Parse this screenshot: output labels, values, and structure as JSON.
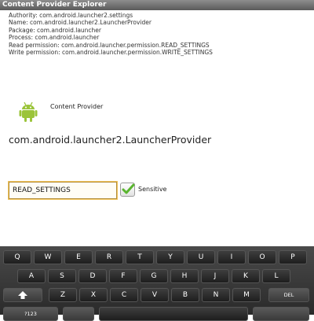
{
  "titlebar": {
    "title": "Content Provider Explorer"
  },
  "info": {
    "authority": "Authority: com.android.launcher2.settings",
    "name": "Name: com.android.launcher2.LauncherProvider",
    "package": "Package: com.android.launcher",
    "process": "Process: com.android.launcher",
    "read_permission": "Read permission: com.android.launcher.permission.READ_SETTINGS",
    "write_permission": "Write permission: com.android.launcher.permission.WRITE_SETTINGS"
  },
  "provider_section": {
    "icon": "android-icon",
    "label": "Content Provider",
    "provider_name": "com.android.launcher2.LauncherProvider"
  },
  "permission_input": {
    "value": "READ_SETTINGS"
  },
  "sensitive": {
    "label": "Sensitive",
    "checked": true
  },
  "keyboard": {
    "row1": [
      "Q",
      "W",
      "E",
      "R",
      "T",
      "Y",
      "U",
      "I",
      "O",
      "P"
    ],
    "row2": [
      "A",
      "S",
      "D",
      "F",
      "G",
      "H",
      "J",
      "K",
      "L"
    ],
    "row3": [
      "Z",
      "X",
      "C",
      "V",
      "B",
      "N",
      "M"
    ],
    "shift_icon": "shift-arrow-icon",
    "del_label": "DEL",
    "symbols_label": "?123"
  },
  "colors": {
    "titlebar": "#6e6e6e",
    "input_border": "#f1c45c",
    "checkbox_check": "#5ab52f",
    "android_green": "#9bc43a"
  }
}
